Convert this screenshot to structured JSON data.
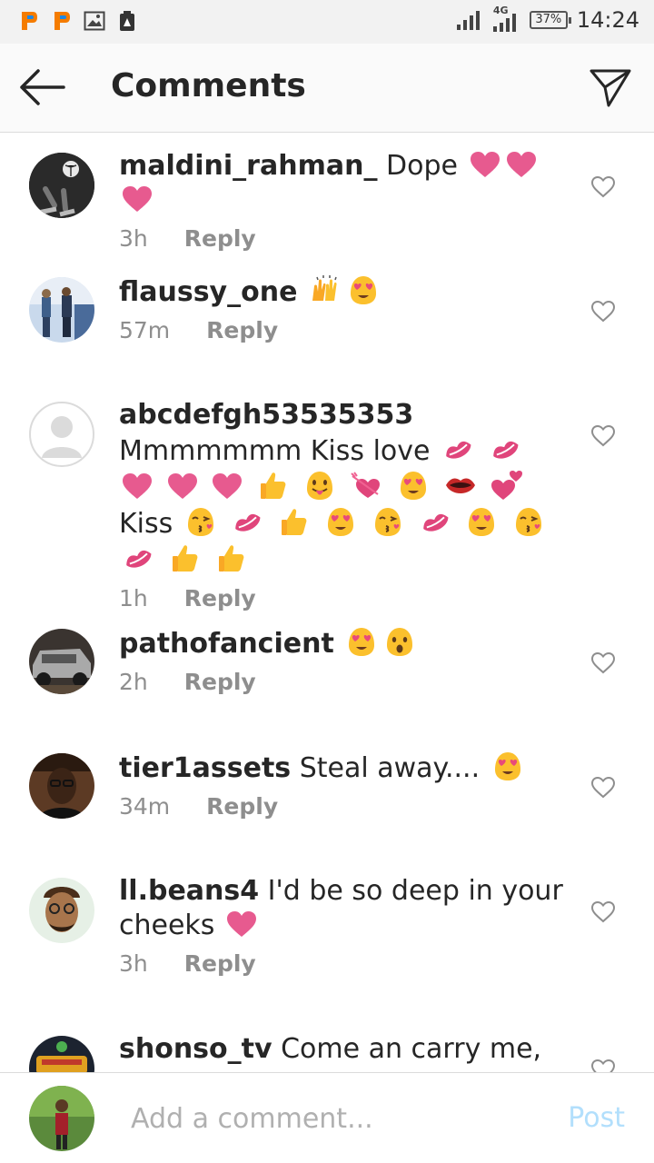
{
  "status_bar": {
    "signal_label": "4G",
    "battery": "37%",
    "time": "14:24"
  },
  "header": {
    "title": "Comments"
  },
  "comments": [
    {
      "username": "maldini_rahman_",
      "text": "Dope",
      "time": "3h",
      "reply": "Reply"
    },
    {
      "username": "flaussy_one",
      "text": "",
      "time": "57m",
      "reply": "Reply"
    },
    {
      "username": "abcdefgh53535353",
      "text_a": "Mmmmmmm Kiss love",
      "text_b": "Kiss",
      "time": "1h",
      "reply": "Reply"
    },
    {
      "username": "pathofancient",
      "text": "",
      "time": "2h",
      "reply": "Reply"
    },
    {
      "username": "tier1assets",
      "text": "Steal away....",
      "time": "34m",
      "reply": "Reply"
    },
    {
      "username": "ll.beans4",
      "text": "I'd be so deep in your cheeks",
      "time": "3h",
      "reply": "Reply"
    },
    {
      "username": "shonso_tv",
      "text": "Come an carry me,",
      "time": "",
      "reply": ""
    }
  ],
  "composer": {
    "placeholder": "Add a comment...",
    "post_label": "Post"
  },
  "colors": {
    "accent_blue_disabled": "#b2dffc",
    "heart_pink": "#e75a8f",
    "emoji_yellow": "#fbc02d"
  }
}
